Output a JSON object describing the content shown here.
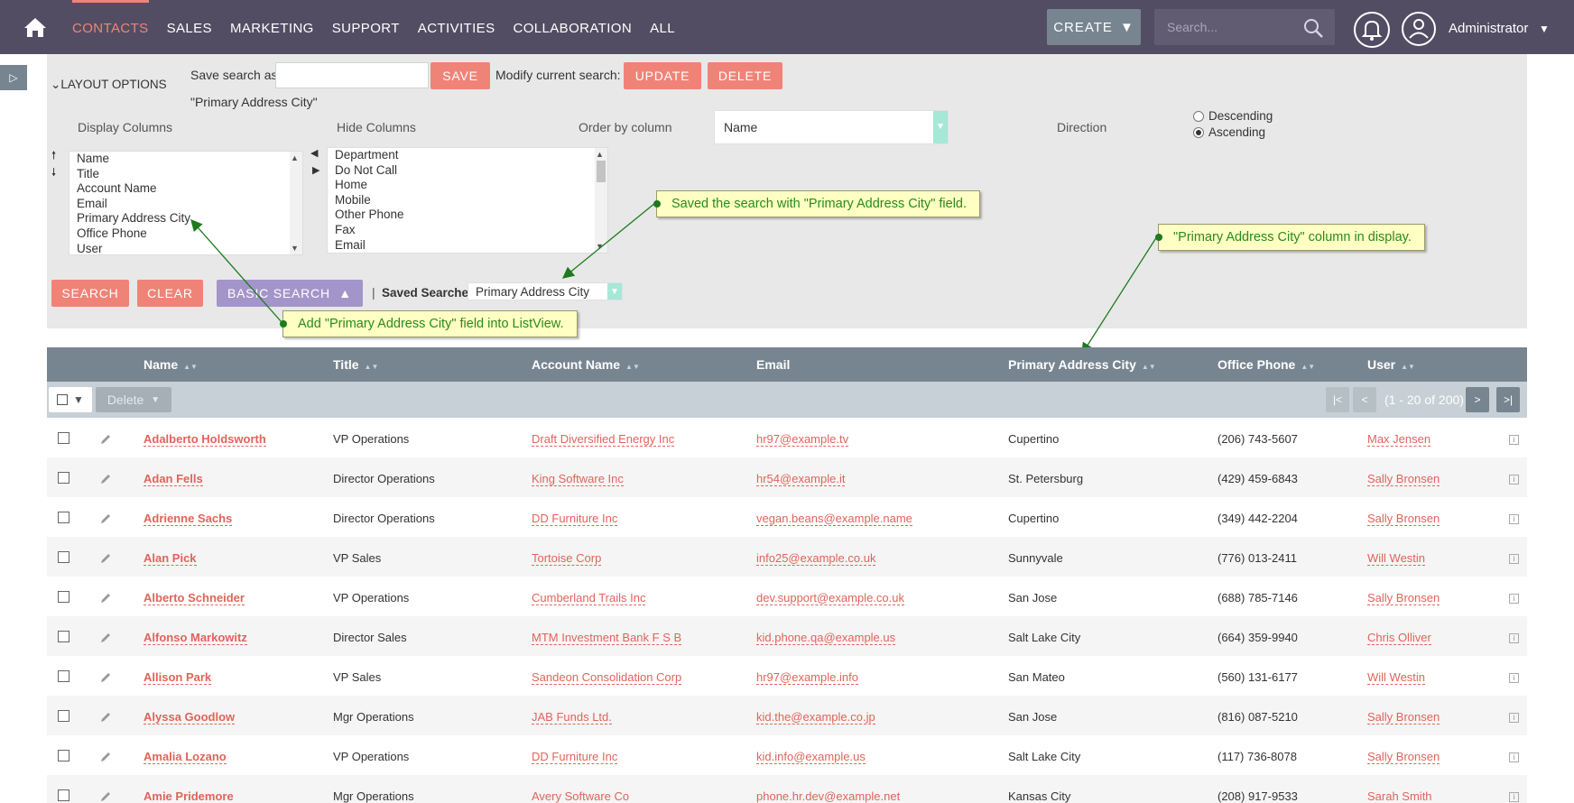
{
  "nav": {
    "menu": [
      "CONTACTS",
      "SALES",
      "MARKETING",
      "SUPPORT",
      "ACTIVITIES",
      "COLLABORATION",
      "ALL"
    ],
    "create_label": "CREATE",
    "search_placeholder": "Search...",
    "user": "Administrator"
  },
  "search": {
    "layout_options": "LAYOUT OPTIONS",
    "save_search_label": "Save search as:",
    "save_search_value": "",
    "save_btn": "SAVE",
    "modify_label": "Modify current search:",
    "update_btn": "UPDATE",
    "delete_btn": "DELETE",
    "saved_name": "\"Primary Address City\"",
    "display_columns_label": "Display Columns",
    "hide_columns_label": "Hide Columns",
    "order_by_label": "Order by column",
    "order_by_value": "Name",
    "direction_label": "Direction",
    "direction_options": [
      "Descending",
      "Ascending"
    ],
    "direction_selected": "Ascending",
    "display_columns": [
      "Name",
      "Title",
      "Account Name",
      "Email",
      "Primary Address City",
      "Office Phone",
      "User"
    ],
    "hide_columns": [
      "Department",
      "Do Not Call",
      "Home",
      "Mobile",
      "Other Phone",
      "Fax",
      "Email"
    ],
    "search_btn": "SEARCH",
    "clear_btn": "CLEAR",
    "basic_search_btn": "BASIC SEARCH",
    "saved_searches_label": "Saved Searches",
    "saved_searches_value": "Primary Address City"
  },
  "callouts": {
    "saved": "Saved the search with \"Primary Address City\" field.",
    "column": "\"Primary Address City\" column in display.",
    "add": "Add \"Primary Address City\" field into ListView."
  },
  "table": {
    "headers": [
      "Name",
      "Title",
      "Account Name",
      "Email",
      "Primary Address City",
      "Office Phone",
      "User"
    ],
    "delete_label": "Delete",
    "pagination": "(1 - 20 of 200)",
    "rows": [
      [
        "Adalberto Holdsworth",
        "VP Operations",
        "Draft Diversified Energy Inc",
        "hr97@example.tv",
        "Cupertino",
        "(206) 743-5607",
        "Max Jensen"
      ],
      [
        "Adan Fells",
        "Director Operations",
        "King Software Inc",
        "hr54@example.it",
        "St. Petersburg",
        "(429) 459-6843",
        "Sally Bronsen"
      ],
      [
        "Adrienne Sachs",
        "Director Operations",
        "DD Furniture Inc",
        "vegan.beans@example.name",
        "Cupertino",
        "(349) 442-2204",
        "Sally Bronsen"
      ],
      [
        "Alan Pick",
        "VP Sales",
        "Tortoise Corp",
        "info25@example.co.uk",
        "Sunnyvale",
        "(776) 013-2411",
        "Will Westin"
      ],
      [
        "Alberto Schneider",
        "VP Operations",
        "Cumberland Trails Inc",
        "dev.support@example.co.uk",
        "San Jose",
        "(688) 785-7146",
        "Sally Bronsen"
      ],
      [
        "Alfonso Markowitz",
        "Director Sales",
        "MTM Investment Bank F S B",
        "kid.phone.qa@example.us",
        "Salt Lake City",
        "(664) 359-9940",
        "Chris Olliver"
      ],
      [
        "Allison Park",
        "VP Sales",
        "Sandeon Consolidation Corp",
        "hr97@example.info",
        "San Mateo",
        "(560) 131-6177",
        "Will Westin"
      ],
      [
        "Alyssa Goodlow",
        "Mgr Operations",
        "JAB Funds Ltd.",
        "kid.the@example.co.jp",
        "San Jose",
        "(816) 087-5210",
        "Sally Bronsen"
      ],
      [
        "Amalia Lozano",
        "VP Operations",
        "DD Furniture Inc",
        "kid.info@example.us",
        "Salt Lake City",
        "(117) 736-8078",
        "Sally Bronsen"
      ],
      [
        "Amie Pridemore",
        "Mgr Operations",
        "Avery Software Co",
        "phone.hr.dev@example.net",
        "Kansas City",
        "(208) 917-9533",
        "Sarah Smith"
      ]
    ]
  }
}
